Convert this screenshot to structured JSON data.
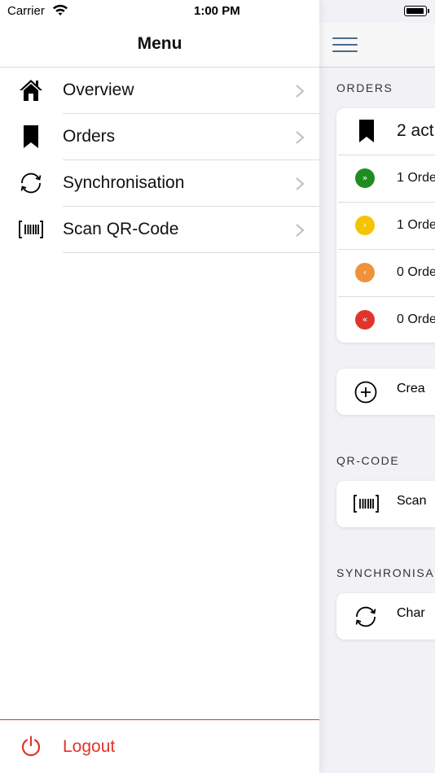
{
  "status_bar": {
    "carrier": "Carrier",
    "time": "1:00 PM"
  },
  "drawer": {
    "title": "Menu",
    "items": [
      {
        "label": "Overview",
        "icon": "home-icon"
      },
      {
        "label": "Orders",
        "icon": "bookmark-icon"
      },
      {
        "label": "Synchronisation",
        "icon": "sync-icon"
      },
      {
        "label": "Scan QR-Code",
        "icon": "barcode-icon"
      }
    ],
    "logout": {
      "label": "Logout",
      "icon": "power-icon",
      "color": "#e0352b"
    }
  },
  "main": {
    "orders_header": "ORDERS",
    "orders_summary": "2 act",
    "priority_rows": [
      {
        "label": "1 Orde",
        "color": "#1e8c1e",
        "icon": "double-chevron-down-icon"
      },
      {
        "label": "1 Orde",
        "color": "#f5c400",
        "icon": "chevron-down-icon"
      },
      {
        "label": "0 Orde",
        "color": "#f0923a",
        "icon": "chevron-up-icon"
      },
      {
        "label": "0 Orde",
        "color": "#e0352b",
        "icon": "double-chevron-up-icon"
      }
    ],
    "create_label": "Crea",
    "qr_header": "QR-CODE",
    "scan_label": "Scan",
    "sync_header": "SYNCHRONISA",
    "sync_label": "Char"
  }
}
